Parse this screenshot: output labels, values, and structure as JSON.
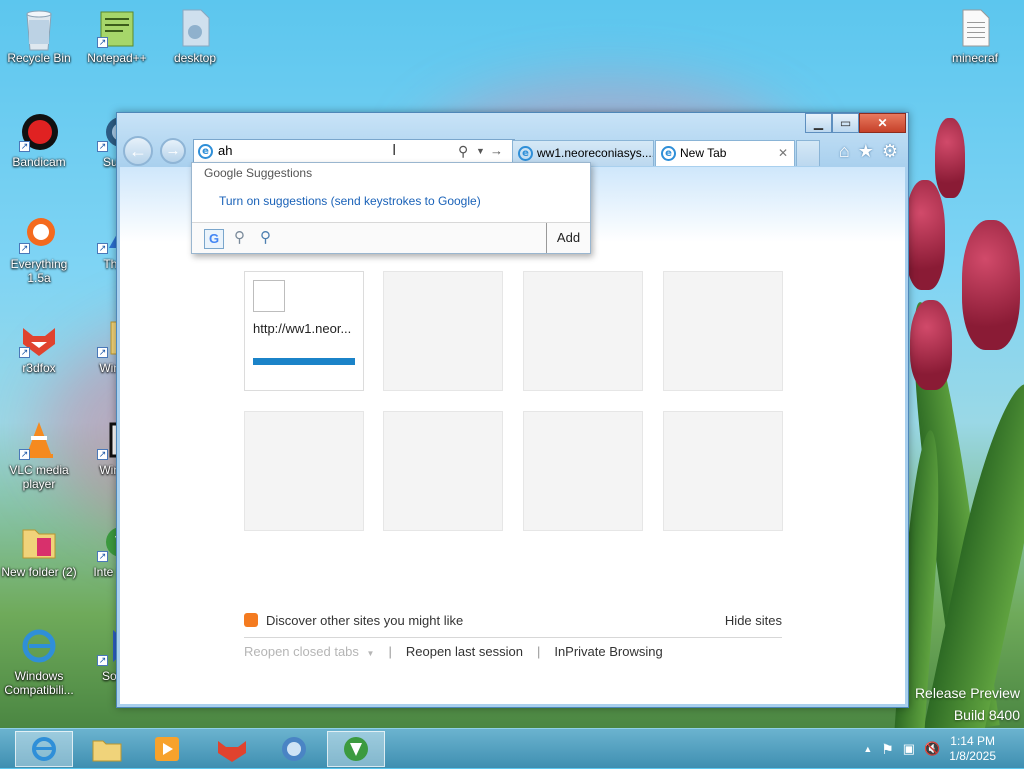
{
  "desktop": {
    "icons": [
      {
        "label": "Recycle Bin"
      },
      {
        "label": "Notepad++"
      },
      {
        "label": "desktop"
      },
      {
        "label": "minecraf"
      },
      {
        "label": "Bandicam"
      },
      {
        "label": "Supe"
      },
      {
        "label": "Everything 1.5a"
      },
      {
        "label": "Thun"
      },
      {
        "label": "r3dfox"
      },
      {
        "label": "WinSe"
      },
      {
        "label": "VLC media player"
      },
      {
        "label": "WinSe"
      },
      {
        "label": "New folder (2)"
      },
      {
        "label": "Inte Dow"
      },
      {
        "label": "Windows Compatibili..."
      },
      {
        "label": "Souls"
      }
    ],
    "watermark": {
      "line1": "Release Preview",
      "line2": "Build 8400"
    }
  },
  "browser": {
    "address_value": "ah",
    "tabs": [
      {
        "label": "ww1.neoreconiasys...."
      },
      {
        "label": "New Tab",
        "close": "✕"
      }
    ],
    "window_buttons": {
      "minimize": "▁",
      "maximize": "▭",
      "close": "✕"
    },
    "toolbar": {
      "home": "⌂",
      "favorites": "★",
      "tools": "⚙"
    },
    "suggestions": {
      "header": "Google Suggestions",
      "link": "Turn on suggestions (send keystrokes to Google)",
      "add_label": "Add",
      "google_glyph": "G"
    },
    "new_tab": {
      "tiles": [
        {
          "url": "http://ww1.neor..."
        },
        {
          "url": ""
        },
        {
          "url": ""
        },
        {
          "url": ""
        },
        {
          "url": ""
        },
        {
          "url": ""
        },
        {
          "url": ""
        },
        {
          "url": ""
        }
      ],
      "discover_text": "Discover other sites you might like",
      "hide_sites": "Hide sites",
      "reopen_closed": "Reopen closed tabs",
      "reopen_last": "Reopen last session",
      "inprivate": "InPrivate Browsing",
      "separator": "|"
    }
  },
  "taskbar": {
    "apps": [
      "internet-explorer",
      "file-explorer",
      "media-player",
      "r3dfox",
      "network-tool",
      "internet-download-manager"
    ],
    "clock": {
      "time": "1:14 PM",
      "date": "1/8/2025"
    }
  },
  "colors": {
    "accent": "#1b83c8",
    "link": "#1a62b8",
    "taskbar": "#3f8fb1"
  }
}
